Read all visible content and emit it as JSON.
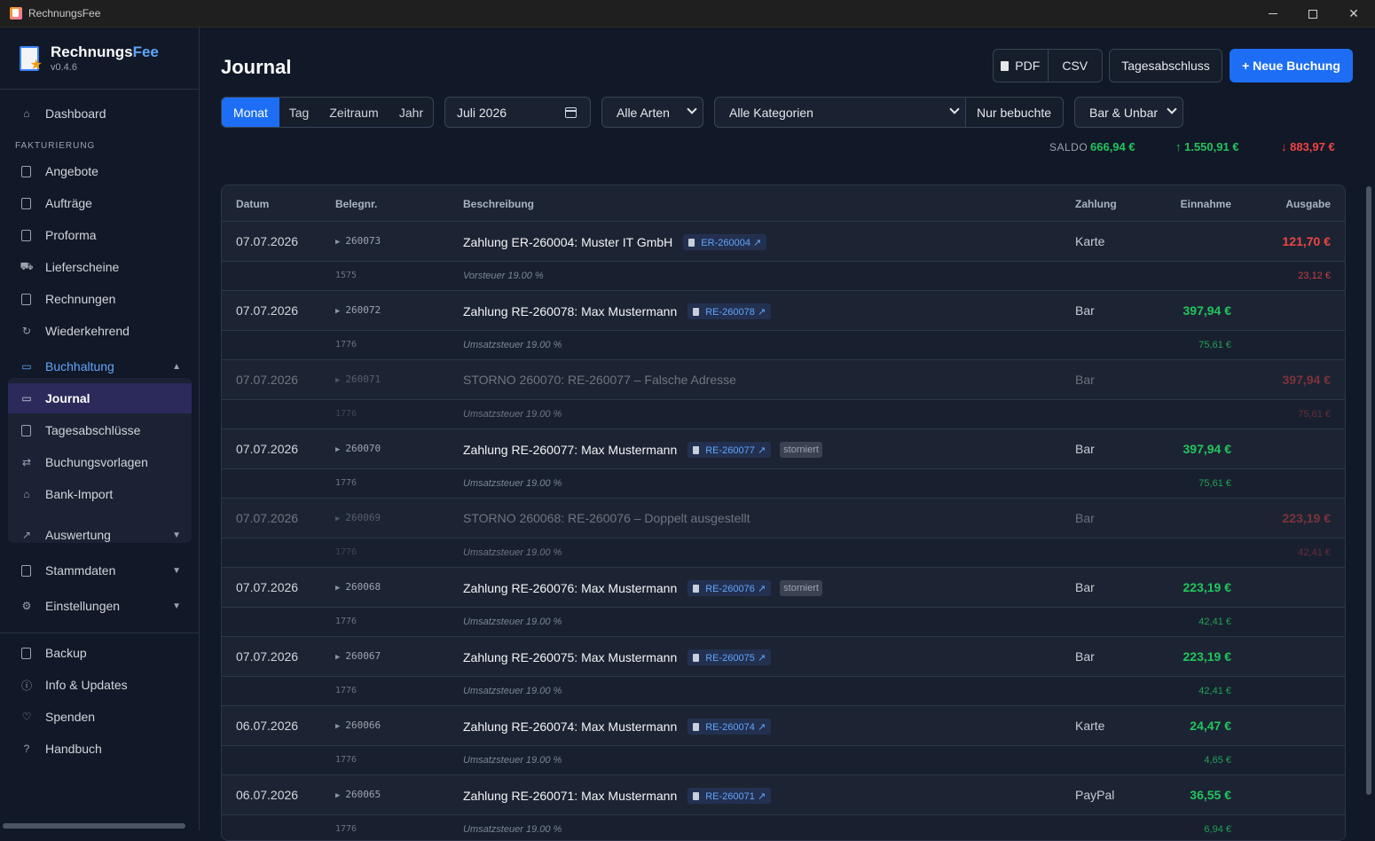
{
  "window": {
    "title": "RechnungsFee"
  },
  "brand": {
    "name_a": "Rechnungs",
    "name_b": "Fee",
    "version": "v0.4.6"
  },
  "sidebar": {
    "dashboard": "Dashboard",
    "section_fakturierung": "FAKTURIERUNG",
    "items": [
      "Angebote",
      "Aufträge",
      "Proforma",
      "Lieferscheine",
      "Rechnungen",
      "Wiederkehrend"
    ],
    "buchhaltung": {
      "label": "Buchhaltung",
      "children": [
        "Journal",
        "Tagesabschlüsse",
        "Buchungsvorlagen",
        "Bank-Import"
      ],
      "active": "Journal"
    },
    "collapsed": [
      "Auswertung",
      "Stammdaten",
      "Einstellungen"
    ],
    "footer": [
      "Backup",
      "Info & Updates",
      "Spenden",
      "Handbuch"
    ]
  },
  "header": {
    "title": "Journal",
    "pdf": "PDF",
    "csv": "CSV",
    "tagesabschluss": "Tagesabschluss",
    "new_booking": "+ Neue Buchung"
  },
  "filters": {
    "tabs": [
      "Monat",
      "Tag",
      "Zeitraum",
      "Jahr"
    ],
    "active_tab": "Monat",
    "month": "Juli 2026",
    "types": "Alle Arten",
    "categories": "Alle Kategorien",
    "only_booked": "Nur bebuchte",
    "payment": "Bar & Unbar"
  },
  "summary": {
    "saldo_label": "SALDO",
    "saldo": "666,94 €",
    "income": "↑ 1.550,91 €",
    "expense": "↓ 883,97 €"
  },
  "table": {
    "headers": {
      "date": "Datum",
      "beleg": "Belegnr.",
      "desc": "Beschreibung",
      "pay": "Zahlung",
      "in": "Einnahme",
      "out": "Ausgabe"
    },
    "rows": [
      {
        "date": "07.07.2026",
        "beleg": "260073",
        "desc": "Zahlung ER-260004: Muster IT GmbH",
        "badge": "ER-260004 ↗",
        "storno": "",
        "pay": "Karte",
        "in": "",
        "out": "121,70 €",
        "dim": false,
        "sub": {
          "account": "1575",
          "desc": "Vorsteuer 19.00 %",
          "in": "",
          "out": "23,12 €"
        }
      },
      {
        "date": "07.07.2026",
        "beleg": "260072",
        "desc": "Zahlung RE-260078: Max Mustermann",
        "badge": "RE-260078 ↗",
        "storno": "",
        "pay": "Bar",
        "in": "397,94 €",
        "out": "",
        "dim": false,
        "sub": {
          "account": "1776",
          "desc": "Umsatzsteuer 19.00 %",
          "in": "75,61 €",
          "out": ""
        }
      },
      {
        "date": "07.07.2026",
        "beleg": "260071",
        "desc": "STORNO 260070: RE-260077 – Falsche Adresse",
        "badge": "",
        "storno": "",
        "pay": "Bar",
        "in": "",
        "out": "397,94 €",
        "dim": true,
        "sub": {
          "account": "1776",
          "desc": "Umsatzsteuer 19.00 %",
          "in": "",
          "out": "75,61 €"
        }
      },
      {
        "date": "07.07.2026",
        "beleg": "260070",
        "desc": "Zahlung RE-260077: Max Mustermann",
        "badge": "RE-260077 ↗",
        "storno": "storniert",
        "pay": "Bar",
        "in": "397,94 €",
        "out": "",
        "dim": false,
        "sub": {
          "account": "1776",
          "desc": "Umsatzsteuer 19.00 %",
          "in": "75,61 €",
          "out": ""
        }
      },
      {
        "date": "07.07.2026",
        "beleg": "260069",
        "desc": "STORNO 260068: RE-260076 – Doppelt ausgestellt",
        "badge": "",
        "storno": "",
        "pay": "Bar",
        "in": "",
        "out": "223,19 €",
        "dim": true,
        "sub": {
          "account": "1776",
          "desc": "Umsatzsteuer 19.00 %",
          "in": "",
          "out": "42,41 €"
        }
      },
      {
        "date": "07.07.2026",
        "beleg": "260068",
        "desc": "Zahlung RE-260076: Max Mustermann",
        "badge": "RE-260076 ↗",
        "storno": "storniert",
        "pay": "Bar",
        "in": "223,19 €",
        "out": "",
        "dim": false,
        "sub": {
          "account": "1776",
          "desc": "Umsatzsteuer 19.00 %",
          "in": "42,41 €",
          "out": ""
        }
      },
      {
        "date": "07.07.2026",
        "beleg": "260067",
        "desc": "Zahlung RE-260075: Max Mustermann",
        "badge": "RE-260075 ↗",
        "storno": "",
        "pay": "Bar",
        "in": "223,19 €",
        "out": "",
        "dim": false,
        "sub": {
          "account": "1776",
          "desc": "Umsatzsteuer 19.00 %",
          "in": "42,41 €",
          "out": ""
        }
      },
      {
        "date": "06.07.2026",
        "beleg": "260066",
        "desc": "Zahlung RE-260074: Max Mustermann",
        "badge": "RE-260074 ↗",
        "storno": "",
        "pay": "Karte",
        "in": "24,47 €",
        "out": "",
        "dim": false,
        "sub": {
          "account": "1776",
          "desc": "Umsatzsteuer 19.00 %",
          "in": "4,65 €",
          "out": ""
        }
      },
      {
        "date": "06.07.2026",
        "beleg": "260065",
        "desc": "Zahlung RE-260071: Max Mustermann",
        "badge": "RE-260071 ↗",
        "storno": "",
        "pay": "PayPal",
        "in": "36,55 €",
        "out": "",
        "dim": false,
        "sub": {
          "account": "1776",
          "desc": "Umsatzsteuer 19.00 %",
          "in": "6,94 €",
          "out": ""
        }
      }
    ]
  },
  "colors": {
    "accent": "#1d6ef5",
    "income": "#22c55e",
    "expense": "#ef4444",
    "bg": "#111827"
  }
}
